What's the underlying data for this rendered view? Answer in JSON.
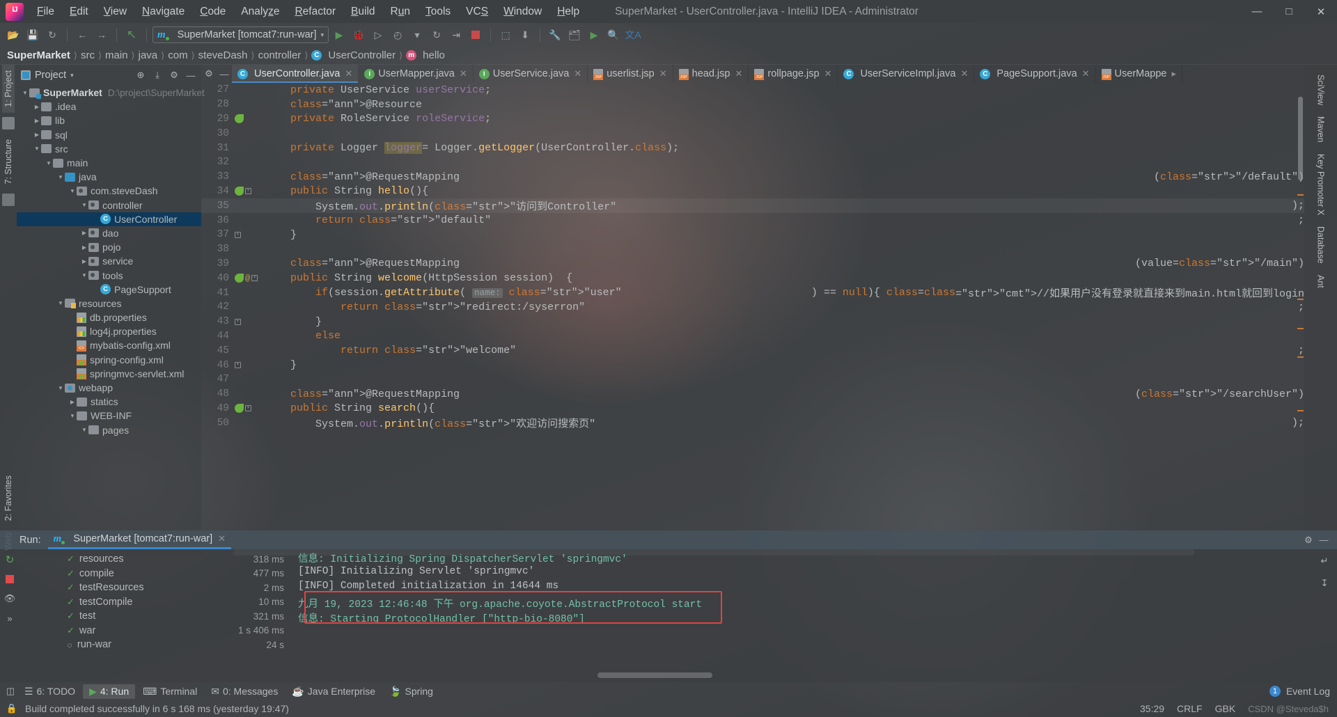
{
  "window": {
    "title": "SuperMarket - UserController.java - IntelliJ IDEA - Administrator",
    "logo": "intellij-idea-logo",
    "minimize": "—",
    "maximize": "□",
    "close": "✕"
  },
  "menu": [
    {
      "label": "File"
    },
    {
      "label": "Edit"
    },
    {
      "label": "View"
    },
    {
      "label": "Navigate"
    },
    {
      "label": "Code"
    },
    {
      "label": "Analyze"
    },
    {
      "label": "Refactor"
    },
    {
      "label": "Build"
    },
    {
      "label": "Run"
    },
    {
      "label": "Tools"
    },
    {
      "label": "VCS"
    },
    {
      "label": "Window"
    },
    {
      "label": "Help"
    }
  ],
  "toolbar": {
    "open_icon": "📂",
    "save_icon": "💾",
    "sync_icon": "↻",
    "back_icon": "←",
    "forward_icon": "→",
    "revert_icon": "↖",
    "run_config": "SuperMarket [tomcat7:run-war]",
    "run_config_caret": "▾",
    "run_icon": "▶",
    "debug_icon": "🐞",
    "coverage_icon": "▷",
    "profile_icon": "◴",
    "profile_caret": "▾",
    "rerun_icon": "↻",
    "stop_icon": "stop-square",
    "attach_icon": "⬚",
    "update_icon": "⬇",
    "settings_icon": "🔧",
    "project_structure_icon": "🗂",
    "terminal_icon": "▶",
    "search_icon": "🔍",
    "translate_icon": "文A"
  },
  "breadcrumb": [
    {
      "label": "SuperMarket",
      "first": true
    },
    {
      "label": "src"
    },
    {
      "label": "main"
    },
    {
      "label": "java"
    },
    {
      "label": "com"
    },
    {
      "label": "steveDash"
    },
    {
      "label": "controller"
    },
    {
      "label": "UserController",
      "icon": "class-icon"
    },
    {
      "label": "hello",
      "icon": "method-icon"
    }
  ],
  "left_rail": [
    {
      "label": "1: Project",
      "active": true
    },
    {
      "label": "7: Structure",
      "active": false
    }
  ],
  "right_rail": [
    {
      "label": "SciView"
    },
    {
      "label": "Maven"
    },
    {
      "label": "Key Promoter X"
    },
    {
      "label": "Database"
    },
    {
      "label": "Ant"
    }
  ],
  "left_bottom_rail": [
    {
      "label": "2: Favorites"
    },
    {
      "label": "Web"
    }
  ],
  "project_panel": {
    "title": "Project",
    "title_caret": "▾",
    "locate_icon": "⊕",
    "collapse_icon": "⤓",
    "settings_icon": "⚙",
    "hide_icon": "—",
    "tree": [
      {
        "label": "SuperMarket",
        "path": "D:\\project\\SuperMarket",
        "depth": 0,
        "arrow": "▼",
        "icon": "module-folder",
        "bold": true
      },
      {
        "label": ".idea",
        "depth": 1,
        "arrow": "▶",
        "icon": "folder"
      },
      {
        "label": "lib",
        "depth": 1,
        "arrow": "▶",
        "icon": "folder"
      },
      {
        "label": "sql",
        "depth": 1,
        "arrow": "▶",
        "icon": "folder"
      },
      {
        "label": "src",
        "depth": 1,
        "arrow": "▼",
        "icon": "folder"
      },
      {
        "label": "main",
        "depth": 2,
        "arrow": "▼",
        "icon": "folder"
      },
      {
        "label": "java",
        "depth": 3,
        "arrow": "▼",
        "icon": "source-folder"
      },
      {
        "label": "com.steveDash",
        "depth": 4,
        "arrow": "▼",
        "icon": "package"
      },
      {
        "label": "controller",
        "depth": 5,
        "arrow": "▼",
        "icon": "package"
      },
      {
        "label": "UserController",
        "depth": 6,
        "arrow": "",
        "icon": "class",
        "selected": true
      },
      {
        "label": "dao",
        "depth": 5,
        "arrow": "▶",
        "icon": "package"
      },
      {
        "label": "pojo",
        "depth": 5,
        "arrow": "▶",
        "icon": "package"
      },
      {
        "label": "service",
        "depth": 5,
        "arrow": "▶",
        "icon": "package"
      },
      {
        "label": "tools",
        "depth": 5,
        "arrow": "▼",
        "icon": "package"
      },
      {
        "label": "PageSupport",
        "depth": 6,
        "arrow": "",
        "icon": "class"
      },
      {
        "label": "resources",
        "depth": 3,
        "arrow": "▼",
        "icon": "resource-folder"
      },
      {
        "label": "db.properties",
        "depth": 4,
        "arrow": "",
        "icon": "properties-file"
      },
      {
        "label": "log4j.properties",
        "depth": 4,
        "arrow": "",
        "icon": "properties-file"
      },
      {
        "label": "mybatis-config.xml",
        "depth": 4,
        "arrow": "",
        "icon": "xml-file"
      },
      {
        "label": "spring-config.xml",
        "depth": 4,
        "arrow": "",
        "icon": "spring-file"
      },
      {
        "label": "springmvc-servlet.xml",
        "depth": 4,
        "arrow": "",
        "icon": "spring-file"
      },
      {
        "label": "webapp",
        "depth": 3,
        "arrow": "▼",
        "icon": "webapp-folder"
      },
      {
        "label": "statics",
        "depth": 4,
        "arrow": "▶",
        "icon": "folder"
      },
      {
        "label": "WEB-INF",
        "depth": 4,
        "arrow": "▼",
        "icon": "folder"
      },
      {
        "label": "pages",
        "depth": 5,
        "arrow": "▼",
        "icon": "folder"
      }
    ]
  },
  "editor": {
    "tabs": [
      {
        "label": "UserController.java",
        "icon": "class-icon",
        "active": true,
        "close": "✕"
      },
      {
        "label": "UserMapper.java",
        "icon": "interface-icon",
        "active": false,
        "close": "✕"
      },
      {
        "label": "UserService.java",
        "icon": "interface-icon",
        "active": false,
        "close": "✕"
      },
      {
        "label": "userlist.jsp",
        "icon": "jsp-icon",
        "active": false,
        "close": "✕"
      },
      {
        "label": "head.jsp",
        "icon": "jsp-icon",
        "active": false,
        "close": "✕"
      },
      {
        "label": "rollpage.jsp",
        "icon": "jsp-icon",
        "active": false,
        "close": "✕"
      },
      {
        "label": "UserServiceImpl.java",
        "icon": "class-icon",
        "active": false,
        "close": "✕"
      },
      {
        "label": "PageSupport.java",
        "icon": "class-icon",
        "active": false,
        "close": "✕"
      },
      {
        "label": "UserMappe",
        "icon": "xml-icon",
        "active": false,
        "close": "▸"
      }
    ],
    "tab_settings_icon": "⚙",
    "tab_hide_icon": "—",
    "lines": [
      {
        "n": 27,
        "gutter": "",
        "code": "    private UserService userService;"
      },
      {
        "n": 28,
        "gutter": "",
        "code": "    @Resource"
      },
      {
        "n": 29,
        "gutter": "bean",
        "code": "    private RoleService roleService;"
      },
      {
        "n": 30,
        "gutter": "",
        "code": ""
      },
      {
        "n": 31,
        "gutter": "",
        "code": "    private Logger logger= Logger.getLogger(UserController.class);"
      },
      {
        "n": 32,
        "gutter": "",
        "code": ""
      },
      {
        "n": 33,
        "gutter": "",
        "code": "    @RequestMapping(\"/default\")"
      },
      {
        "n": 34,
        "gutter": "bean-fold",
        "code": "    public String hello(){"
      },
      {
        "n": 35,
        "gutter": "",
        "code": "        System.out.println(\"访问到Controller\");"
      },
      {
        "n": 36,
        "gutter": "",
        "code": "        return \"default\";"
      },
      {
        "n": 37,
        "gutter": "fold-end",
        "code": "    }"
      },
      {
        "n": 38,
        "gutter": "",
        "code": ""
      },
      {
        "n": 39,
        "gutter": "",
        "code": "    @RequestMapping(value=\"/main\")"
      },
      {
        "n": 40,
        "gutter": "bean-at-fold",
        "code": "    public String welcome(HttpSession session)  {"
      },
      {
        "n": 41,
        "gutter": "",
        "code": "        if(session.getAttribute( name: \"user\") == null){ //如果用户没有登录就直接来到main.html就回到login"
      },
      {
        "n": 42,
        "gutter": "",
        "code": "            return \"redirect:/syserron\";"
      },
      {
        "n": 43,
        "gutter": "fold-end",
        "code": "        }"
      },
      {
        "n": 44,
        "gutter": "",
        "code": "        else"
      },
      {
        "n": 45,
        "gutter": "",
        "code": "            return \"welcome\";"
      },
      {
        "n": 46,
        "gutter": "fold-end",
        "code": "    }"
      },
      {
        "n": 47,
        "gutter": "",
        "code": ""
      },
      {
        "n": 48,
        "gutter": "",
        "code": "    @RequestMapping(\"/searchUser\")"
      },
      {
        "n": 49,
        "gutter": "bean-fold",
        "code": "    public String search(){"
      },
      {
        "n": 50,
        "gutter": "",
        "code": "        System.out.println(\"欢迎访问搜索页\");"
      }
    ]
  },
  "run_window": {
    "label": "Run:",
    "tab_title": "SuperMarket [tomcat7:run-war]",
    "tab_close": "✕",
    "settings_icon": "⚙",
    "hide_icon": "—",
    "rerun_icon": "↻",
    "stop_icon": "stop-square",
    "eye_icon": "👁",
    "more_icon": "»",
    "wrap_icon": "↵",
    "scroll_end_icon": "↧",
    "tasks": [
      {
        "name": "resources",
        "time": "318 ms",
        "status": "ok"
      },
      {
        "name": "compile",
        "time": "477 ms",
        "status": "ok"
      },
      {
        "name": "testResources",
        "time": "2 ms",
        "status": "ok"
      },
      {
        "name": "testCompile",
        "time": "10 ms",
        "status": "ok"
      },
      {
        "name": "test",
        "time": "321 ms",
        "status": "ok"
      },
      {
        "name": "war",
        "time": "1 s 406 ms",
        "status": "ok"
      },
      {
        "name": "run-war",
        "time": "24 s",
        "status": "running"
      }
    ],
    "console_lines": [
      {
        "text": "信息: Initializing Spring DispatcherServlet 'springmvc'",
        "style": "cn"
      },
      {
        "text": "[INFO] Initializing Servlet 'springmvc'",
        "style": "plain"
      },
      {
        "text": "[INFO] Completed initialization in 14644 ms",
        "style": "plain"
      },
      {
        "text": "九月 19, 2023 12:46:48 下午 org.apache.coyote.AbstractProtocol start",
        "style": "cn"
      },
      {
        "text": "信息: Starting ProtocolHandler [\"http-bio-8080\"]",
        "style": "cn"
      }
    ],
    "highlight_color": "#e04343"
  },
  "bottom_tabs": [
    {
      "label": "6: TODO",
      "icon": "☰",
      "active": false
    },
    {
      "label": "4: Run",
      "icon": "▶",
      "active": true
    },
    {
      "label": "Terminal",
      "icon": "⌨",
      "active": false
    },
    {
      "label": "0: Messages",
      "icon": "✉",
      "active": false
    },
    {
      "label": "Java Enterprise",
      "icon": "☕",
      "active": false
    },
    {
      "label": "Spring",
      "icon": "🍃",
      "active": false
    }
  ],
  "event_log": {
    "label": "Event Log",
    "count": "1"
  },
  "status_bar": {
    "message": "Build completed successfully in 6 s 168 ms (yesterday 19:47)",
    "caret": "35:29",
    "line_sep": "CRLF",
    "encoding": "GBK",
    "watermark": "CSDN @Steveda$h",
    "lock_icon": "🔒",
    "branch_icon": "⎇"
  }
}
